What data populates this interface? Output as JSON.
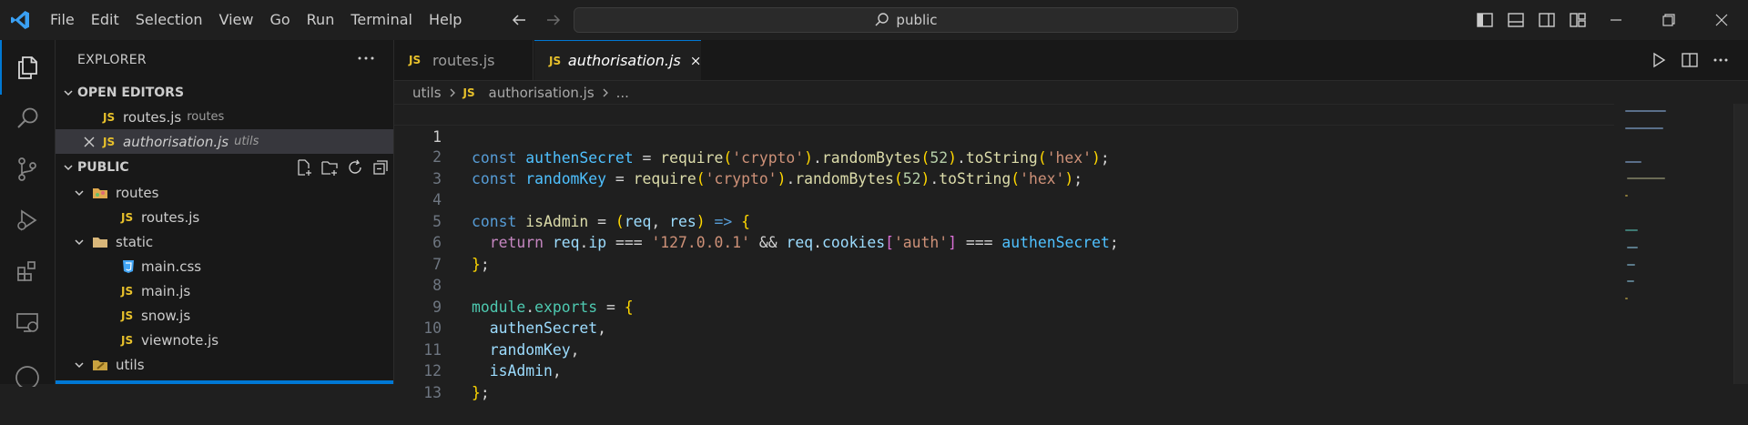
{
  "titlebar": {
    "menu": [
      "File",
      "Edit",
      "Selection",
      "View",
      "Go",
      "Run",
      "Terminal",
      "Help"
    ],
    "search_text": "public",
    "accent": "#0078d4"
  },
  "activity_bar": {
    "items": [
      "explorer-icon",
      "search-icon",
      "source-control-icon",
      "run-debug-icon",
      "extensions-icon",
      "remote-explorer-icon"
    ]
  },
  "sidebar": {
    "header": "EXPLORER",
    "open_editors": {
      "title": "OPEN EDITORS",
      "items": [
        {
          "name": "routes.js",
          "desc": "routes"
        },
        {
          "name": "authorisation.js",
          "desc": "utils"
        }
      ]
    },
    "public": {
      "title": "PUBLIC",
      "tree": [
        {
          "name": "routes",
          "type": "folder"
        },
        {
          "name": "routes.js",
          "type": "js"
        },
        {
          "name": "static",
          "type": "folder"
        },
        {
          "name": "main.css",
          "type": "css"
        },
        {
          "name": "main.js",
          "type": "js"
        },
        {
          "name": "snow.js",
          "type": "js"
        },
        {
          "name": "viewnote.js",
          "type": "js"
        },
        {
          "name": "utils",
          "type": "folder"
        }
      ]
    }
  },
  "tabs": [
    {
      "badge": "JS",
      "label": "routes.js",
      "active": false
    },
    {
      "badge": "JS",
      "label": "authorisation.js",
      "active": true
    }
  ],
  "breadcrumb": {
    "folder": "utils",
    "badge": "JS",
    "file": "authorisation.js",
    "more": "..."
  },
  "editor": {
    "line_numbers": [
      "1",
      "2",
      "3",
      "4",
      "5",
      "6",
      "7",
      "8",
      "9",
      "10",
      "11",
      "12",
      "13"
    ],
    "current_line": 1
  }
}
